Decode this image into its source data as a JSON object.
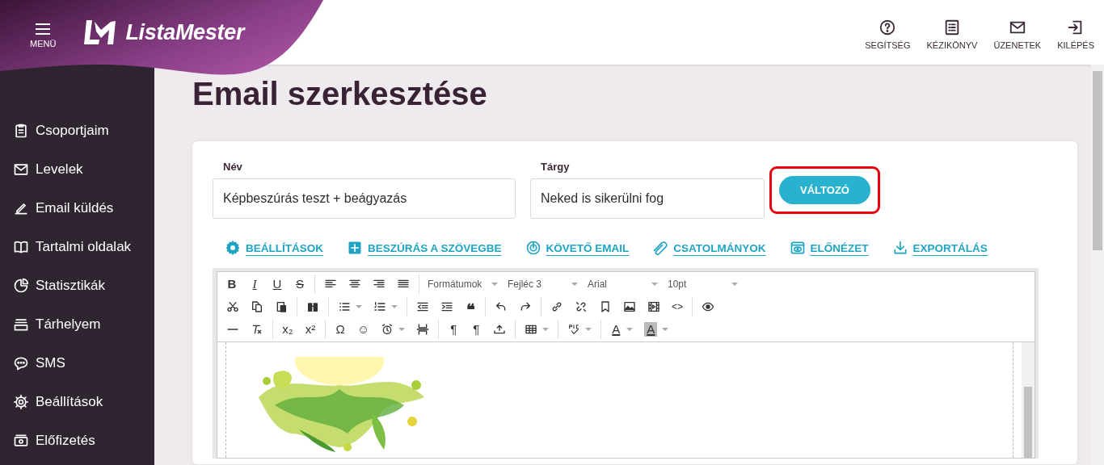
{
  "header": {
    "menu_label": "MENÜ",
    "brand": "ListaMester",
    "links": [
      {
        "label": "SEGÍTSÉG"
      },
      {
        "label": "KÉZIKÖNYV"
      },
      {
        "label": "ÜZENETEK"
      },
      {
        "label": "KILÉPÉS"
      }
    ]
  },
  "sidebar": {
    "items": [
      {
        "label": "Csoportjaim"
      },
      {
        "label": "Levelek"
      },
      {
        "label": "Email küldés"
      },
      {
        "label": "Tartalmi oldalak"
      },
      {
        "label": "Statisztikák"
      },
      {
        "label": "Tárhelyem"
      },
      {
        "label": "SMS"
      },
      {
        "label": "Beállítások"
      },
      {
        "label": "Előfizetés"
      }
    ]
  },
  "page": {
    "title": "Email szerkesztése"
  },
  "form": {
    "name_label": "Név",
    "name_value": "Képbeszúrás teszt + beágyazás",
    "subject_label": "Tárgy",
    "subject_value": "Neked is sikerülni fog",
    "variable_button": {
      "label": "VÁLTOZÓ",
      "highlighted": true
    }
  },
  "actions": [
    {
      "label": "BEÁLLÍTÁSOK"
    },
    {
      "label": "BESZÚRÁS A SZÖVEGBE"
    },
    {
      "label": "KÖVETŐ EMAIL"
    },
    {
      "label": "CSATOLMÁNYOK"
    },
    {
      "label": "ELŐNÉZET"
    },
    {
      "label": "EXPORTÁLÁS"
    }
  ],
  "toolbar": [
    [
      {
        "kind": "glyph",
        "text": "B"
      },
      {
        "kind": "glyph",
        "text": "I"
      },
      {
        "kind": "glyph",
        "text": "U"
      },
      {
        "kind": "glyph",
        "text": "S"
      },
      {
        "kind": "sep"
      },
      {
        "kind": "icon"
      },
      {
        "kind": "icon"
      },
      {
        "kind": "icon"
      },
      {
        "kind": "icon"
      },
      {
        "kind": "sep"
      },
      {
        "kind": "dropdown",
        "text": "Formátumok"
      },
      {
        "kind": "dropdown",
        "text": "Fejléc 3"
      },
      {
        "kind": "dropdown",
        "text": "Arial"
      },
      {
        "kind": "dropdown",
        "text": "10pt"
      }
    ],
    [
      {
        "kind": "icon"
      },
      {
        "kind": "icon"
      },
      {
        "kind": "icon"
      },
      {
        "kind": "sep"
      },
      {
        "kind": "icon"
      },
      {
        "kind": "sep"
      },
      {
        "kind": "icon-menu"
      },
      {
        "kind": "icon-menu"
      },
      {
        "kind": "sep"
      },
      {
        "kind": "icon"
      },
      {
        "kind": "icon"
      },
      {
        "kind": "glyph",
        "text": "❝"
      },
      {
        "kind": "sep"
      },
      {
        "kind": "icon"
      },
      {
        "kind": "icon"
      },
      {
        "kind": "sep"
      },
      {
        "kind": "icon"
      },
      {
        "kind": "icon"
      },
      {
        "kind": "icon"
      },
      {
        "kind": "icon"
      },
      {
        "kind": "icon"
      },
      {
        "kind": "glyph",
        "text": "<>"
      },
      {
        "kind": "sep"
      },
      {
        "kind": "icon"
      }
    ],
    [
      {
        "kind": "icon"
      },
      {
        "kind": "icon"
      },
      {
        "kind": "sep"
      },
      {
        "kind": "glyph",
        "text": "x₂"
      },
      {
        "kind": "glyph",
        "text": "x²"
      },
      {
        "kind": "sep"
      },
      {
        "kind": "glyph",
        "text": "Ω"
      },
      {
        "kind": "glyph",
        "text": "☺"
      },
      {
        "kind": "icon-menu"
      },
      {
        "kind": "icon"
      },
      {
        "kind": "sep"
      },
      {
        "kind": "glyph",
        "text": "¶"
      },
      {
        "kind": "glyph",
        "text": "¶"
      },
      {
        "kind": "icon"
      },
      {
        "kind": "sep"
      },
      {
        "kind": "icon-menu"
      },
      {
        "kind": "sep"
      },
      {
        "kind": "icon-menu"
      },
      {
        "kind": "sep"
      },
      {
        "kind": "glyph-menu",
        "text": "A"
      },
      {
        "kind": "glyph-menu",
        "text": "A"
      }
    ]
  ]
}
